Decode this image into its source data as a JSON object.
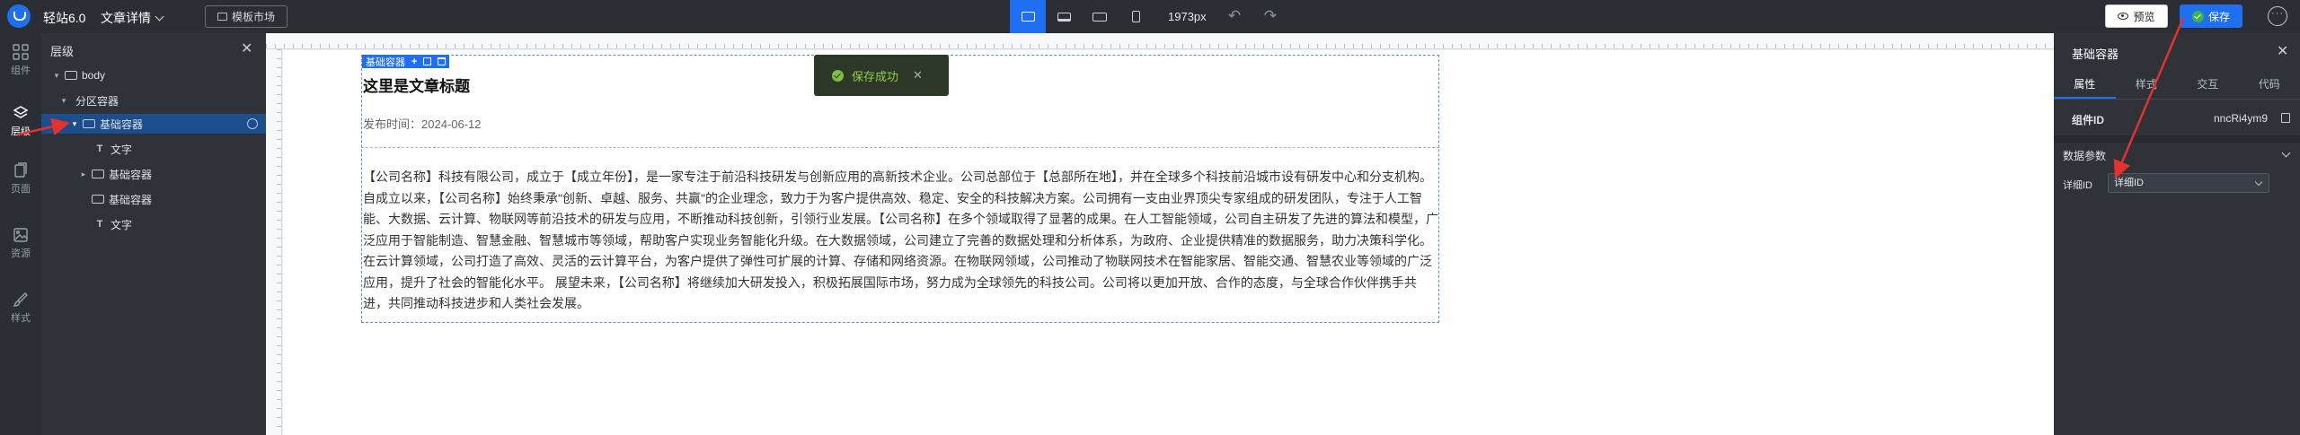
{
  "header": {
    "app_name": "轻站6.0",
    "page_name": "文章详情",
    "template_button": "模板市场",
    "width_readout": "1973px",
    "preview_label": "预览",
    "save_label": "保存"
  },
  "rail": {
    "items": [
      {
        "label": "组件",
        "icon": "components-icon"
      },
      {
        "label": "层级",
        "icon": "layers-icon"
      },
      {
        "label": "页面",
        "icon": "page-icon"
      },
      {
        "label": "资源",
        "icon": "image-icon"
      },
      {
        "label": "样式",
        "icon": "brush-icon"
      }
    ]
  },
  "layers": {
    "title": "层级",
    "nodes": [
      {
        "label": "body",
        "icon": "container-icon"
      },
      {
        "label": "分区容器",
        "icon": "container-icon"
      },
      {
        "label": "基础容器",
        "icon": "container-icon"
      },
      {
        "label": "文字",
        "icon": "text-icon"
      },
      {
        "label": "基础容器",
        "icon": "container-icon"
      },
      {
        "label": "基础容器",
        "icon": "container-icon"
      },
      {
        "label": "文字",
        "icon": "text-icon"
      }
    ]
  },
  "canvas": {
    "selection_tag": "基础容器",
    "article_title": "这里是文章标题",
    "publish_time": "发布时间：2024-06-12",
    "article_body": "【公司名称】科技有限公司，成立于【成立年份】，是一家专注于前沿科技研发与创新应用的高新技术企业。公司总部位于【总部所在地】，并在全球多个科技前沿城市设有研发中心和分支机构。 自成立以来，【公司名称】始终秉承\"创新、卓越、服务、共赢\"的企业理念，致力于为客户提供高效、稳定、安全的科技解决方案。公司拥有一支由业界顶尖专家组成的研发团队，专注于人工智能、大数据、云计算、物联网等前沿技术的研发与应用，不断推动科技创新，引领行业发展。【公司名称】在多个领域取得了显著的成果。在人工智能领域，公司自主研发了先进的算法和模型，广泛应用于智能制造、智慧金融、智慧城市等领域，帮助客户实现业务智能化升级。在大数据领域，公司建立了完善的数据处理和分析体系，为政府、企业提供精准的数据服务，助力决策科学化。在云计算领域，公司打造了高效、灵活的云计算平台，为客户提供了弹性可扩展的计算、存储和网络资源。在物联网领域，公司推动了物联网技术在智能家居、智能交通、智慧农业等领域的广泛应用，提升了社会的智能化水平。 展望未来，【公司名称】将继续加大研发投入，积极拓展国际市场，努力成为全球领先的科技公司。公司将以更加开放、合作的态度，与全球合作伙伴携手共进，共同推动科技进步和人类社会发展。",
    "toast": "保存成功"
  },
  "right_panel": {
    "title": "基础容器",
    "tabs": [
      "属性",
      "样式",
      "交互",
      "代码"
    ],
    "component_id_label": "组件ID",
    "component_id": "nncRi4ym9",
    "section_title": "数据参数",
    "detail_id_label": "详细ID",
    "detail_id_value": "详细ID"
  },
  "colors": {
    "accent": "#1f6ff2",
    "annotation_arrow": "#e5322d",
    "toast_text": "#8ed04b"
  }
}
